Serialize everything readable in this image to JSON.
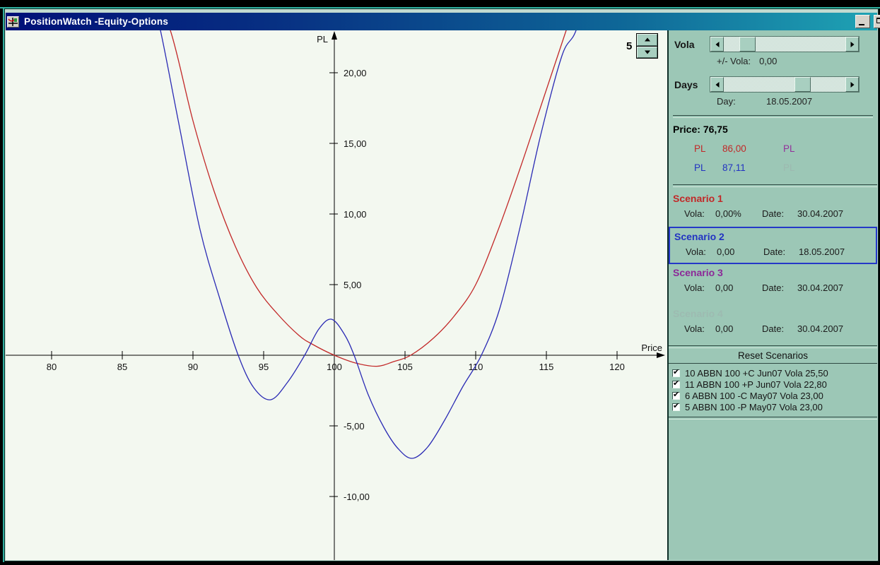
{
  "window": {
    "title": "PositionWatch -Equity-Options"
  },
  "chart": {
    "spinner_value": "5"
  },
  "chart_data": {
    "type": "line",
    "title": "",
    "xlabel": "Price",
    "ylabel": "PL",
    "xlim": [
      76.75,
      123.5
    ],
    "ylim": [
      -14.5,
      23.5
    ],
    "grid": false,
    "legend_position": "none",
    "x_ticks": [
      80,
      85,
      90,
      95,
      100,
      105,
      110,
      115,
      120
    ],
    "x_tick_labels": [
      "80",
      "85",
      "90",
      "95",
      "100",
      "105",
      "110",
      "115",
      "120"
    ],
    "y_ticks": [
      20,
      15,
      10,
      5,
      -5,
      -10
    ],
    "y_tick_labels": [
      "20,00",
      "15,00",
      "10,00",
      "5,00",
      "-5,00",
      "-10,00"
    ],
    "series": [
      {
        "name": "red",
        "color": "#c22828",
        "points": [
          [
            86.9,
            26
          ],
          [
            88.4,
            23
          ],
          [
            90,
            16.6
          ],
          [
            91.5,
            11.6
          ],
          [
            93,
            7.7
          ],
          [
            94.5,
            4.8
          ],
          [
            96,
            2.9
          ],
          [
            97.5,
            1.4
          ],
          [
            98.5,
            0.75
          ],
          [
            100,
            0
          ],
          [
            101.5,
            -0.55
          ],
          [
            103,
            -0.78
          ],
          [
            104.2,
            -0.45
          ],
          [
            105.4,
            0
          ],
          [
            107,
            1.2
          ],
          [
            108.5,
            2.8
          ],
          [
            110,
            5
          ],
          [
            111.6,
            8.9
          ],
          [
            113.2,
            13.4
          ],
          [
            114.8,
            18.2
          ],
          [
            116.4,
            23
          ],
          [
            117.6,
            26.5
          ]
        ]
      },
      {
        "name": "blue",
        "color": "#2a2ab4",
        "points": [
          [
            86.9,
            26
          ],
          [
            87.7,
            23
          ],
          [
            89,
            16.4
          ],
          [
            90.5,
            8.9
          ],
          [
            91.9,
            4
          ],
          [
            93.2,
            0
          ],
          [
            94.3,
            -2.3
          ],
          [
            95.5,
            -3.15
          ],
          [
            96.7,
            -1.9
          ],
          [
            97.9,
            0
          ],
          [
            98.9,
            1.85
          ],
          [
            99.8,
            2.55
          ],
          [
            100.7,
            1.5
          ],
          [
            101.4,
            0
          ],
          [
            102.4,
            -2.8
          ],
          [
            103.5,
            -5.1
          ],
          [
            104.5,
            -6.6
          ],
          [
            105.5,
            -7.3
          ],
          [
            106.6,
            -6.5
          ],
          [
            107.8,
            -4.6
          ],
          [
            109.1,
            -2.2
          ],
          [
            110.4,
            0
          ],
          [
            111.7,
            3.3
          ],
          [
            113.1,
            8.9
          ],
          [
            114.6,
            15.6
          ],
          [
            116.1,
            21.2
          ],
          [
            117.1,
            23
          ],
          [
            118.3,
            27
          ]
        ]
      }
    ]
  },
  "panel": {
    "vola": {
      "label": "Vola",
      "readout_label": "+/- Vola:",
      "readout_value": "0,00",
      "thumb_pos": 13
    },
    "days": {
      "label": "Days",
      "readout_label": "Day:",
      "readout_value": "18.05.2007",
      "thumb_pos": 58
    },
    "price_label": "Price:",
    "price_value": "76,75",
    "pl_rows": [
      {
        "label": "PL",
        "value": "86,00",
        "right_label": "PL",
        "color": "#c22828",
        "right_color": "#93319b"
      },
      {
        "label": "PL",
        "value": "87,11",
        "right_label": "PL",
        "color": "#2233c2",
        "right_color": "#9db9b0"
      }
    ],
    "scenarios": [
      {
        "name": "Scenario 1",
        "color": "#c22828",
        "vola_label": "Vola:",
        "vola": "0,00%",
        "date_label": "Date:",
        "date": "30.04.2007",
        "selected": false
      },
      {
        "name": "Scenario 2",
        "color": "#2233c2",
        "vola_label": "Vola:",
        "vola": "0,00",
        "date_label": "Date:",
        "date": "18.05.2007",
        "selected": true
      },
      {
        "name": "Scenario 3",
        "color": "#8c2898",
        "vola_label": "Vola:",
        "vola": "0,00",
        "date_label": "Date:",
        "date": "30.04.2007",
        "selected": false
      },
      {
        "name": "Scenario 4",
        "color": "#9dbbb1",
        "vola_label": "Vola:",
        "vola": "0,00",
        "date_label": "Date:",
        "date": "30.04.2007",
        "selected": false
      }
    ],
    "reset_button_label": "Reset Scenarios",
    "positions": [
      {
        "checked": true,
        "label": "10 ABBN 100 +C Jun07 Vola 25,50"
      },
      {
        "checked": true,
        "label": "11 ABBN 100 +P Jun07 Vola 22,80"
      },
      {
        "checked": true,
        "label": "6 ABBN 100 -C May07 Vola 23,00"
      },
      {
        "checked": true,
        "label": "5 ABBN 100 -P May07 Vola 23,00"
      }
    ]
  }
}
